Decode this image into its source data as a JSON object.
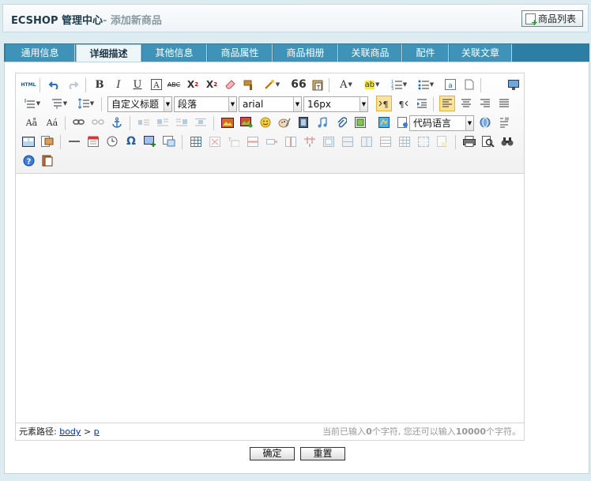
{
  "header": {
    "title": "ECSHOP 管理中心",
    "subtitle": "- 添加新商品",
    "list_button": "商品列表"
  },
  "tabs": [
    {
      "label": "通用信息",
      "active": false
    },
    {
      "label": "详细描述",
      "active": true
    },
    {
      "label": "其他信息",
      "active": false
    },
    {
      "label": "商品属性",
      "active": false
    },
    {
      "label": "商品相册",
      "active": false
    },
    {
      "label": "关联商品",
      "active": false
    },
    {
      "label": "配件",
      "active": false
    },
    {
      "label": "关联文章",
      "active": false
    }
  ],
  "editor": {
    "combos": {
      "custom_title": "自定义标题",
      "paragraph": "段落",
      "font_family": "arial",
      "font_size": "16px",
      "code_language": "代码语言"
    },
    "status": {
      "path_label": "元素路径:",
      "path_items": [
        "body",
        "p"
      ],
      "path_sep": ">",
      "count_prefix": "当前已输入",
      "count_current": "0",
      "count_middle": "个字符, 您还可以输入",
      "count_remaining": "10000",
      "count_suffix": "个字符。"
    },
    "html_icon_text": "HTML"
  },
  "buttons": {
    "confirm": "确定",
    "reset": "重置"
  }
}
